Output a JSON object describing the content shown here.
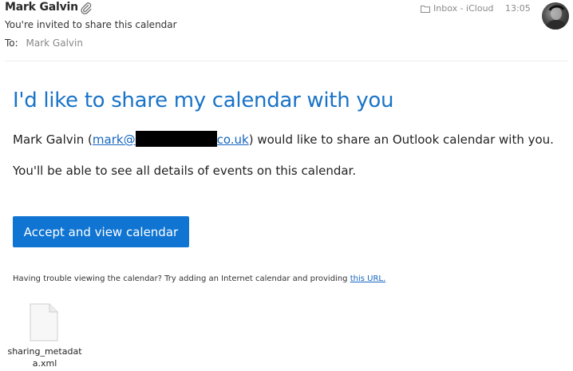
{
  "header": {
    "sender": "Mark Galvin",
    "subject": "You're invited to share this calendar",
    "to_label": "To:",
    "to_name": "Mark Galvin",
    "mailbox": "Inbox - iCloud",
    "time": "13:05"
  },
  "body": {
    "heading": "I'd like to share my calendar with you",
    "line1_name": "Mark Galvin (",
    "email_prefix": "mark@",
    "email_suffix": "co.uk",
    "line1_rest": ") would like to share an Outlook calendar with you.",
    "line2": "You'll be able to see all details of events on this calendar.",
    "accept_button": "Accept and view calendar",
    "trouble_text": "Having trouble viewing the calendar? Try adding an Internet calendar and providing ",
    "trouble_link": "this URL."
  },
  "attachment": {
    "filename": "sharing_metadata.xml"
  },
  "colors": {
    "accent": "#0f74d2",
    "heading": "#1a73c7",
    "link": "#1565c0"
  },
  "icons": {
    "attachment": "paperclip-icon",
    "mailbox": "folder-icon",
    "file": "document-icon"
  }
}
